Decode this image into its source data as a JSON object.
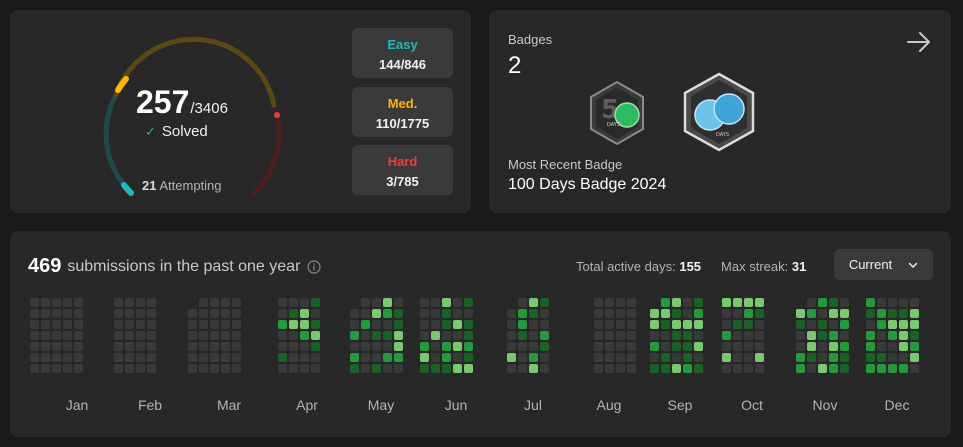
{
  "progress": {
    "solved": "257",
    "total": "/3406",
    "solved_label": "Solved",
    "attempting_count": "21",
    "attempting_label": "Attempting",
    "difficulties": [
      {
        "label": "Easy",
        "count": "144/846",
        "color": "#1cbaba"
      },
      {
        "label": "Med.",
        "count": "110/1775",
        "color": "#ffb700"
      },
      {
        "label": "Hard",
        "count": "3/785",
        "color": "#f63737"
      }
    ]
  },
  "badges": {
    "title": "Badges",
    "count": "2",
    "recent_label": "Most Recent Badge",
    "recent_name": "100 Days Badge 2024",
    "badge_50_text": "DAYS",
    "badge_100_text": "DAYS",
    "arrow_icon": "arrow-right-icon"
  },
  "calendar": {
    "submissions": "469",
    "submissions_text": "submissions in the past one year",
    "active_days_label": "Total active days:",
    "active_days": "155",
    "max_streak_label": "Max streak:",
    "max_streak": "31",
    "dropdown_value": "Current",
    "months": [
      "Jan",
      "Feb",
      "Mar",
      "Apr",
      "May",
      "Jun",
      "Jul",
      "Aug",
      "Sep",
      "Oct",
      "Nov",
      "Dec"
    ]
  },
  "colors": {
    "empty": "#393939",
    "level1": "#196127",
    "level2": "#239a3b",
    "level3": "#7bc96f"
  }
}
